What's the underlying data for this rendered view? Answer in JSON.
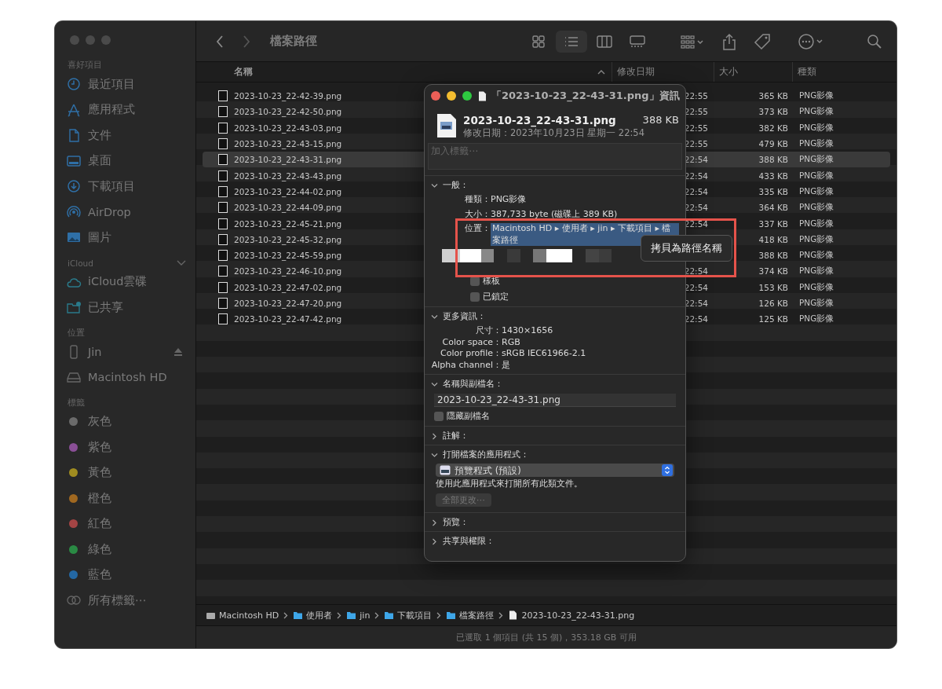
{
  "toolbar": {
    "title": "檔案路徑",
    "view_modes": [
      {
        "kind": "icons",
        "selected": false
      },
      {
        "kind": "list",
        "selected": true
      },
      {
        "kind": "columns",
        "selected": false
      },
      {
        "kind": "gallery",
        "selected": false
      }
    ]
  },
  "sidebar": {
    "sections": [
      {
        "heading": "喜好項目",
        "toggle_visible": false,
        "items": [
          {
            "label": "最近項目",
            "kind": "clock"
          },
          {
            "label": "應用程式",
            "kind": "apps"
          },
          {
            "label": "文件",
            "kind": "doc"
          },
          {
            "label": "桌面",
            "kind": "desktop"
          },
          {
            "label": "下載項目",
            "kind": "download"
          },
          {
            "label": "AirDrop",
            "kind": "airdrop"
          },
          {
            "label": "圖片",
            "kind": "photos"
          }
        ]
      },
      {
        "heading": "iCloud",
        "toggle_visible": true,
        "items": [
          {
            "label": "iCloud雲碟",
            "kind": "cloud"
          },
          {
            "label": "已共享",
            "kind": "shared"
          }
        ]
      },
      {
        "heading": "位置",
        "toggle_visible": false,
        "items": [
          {
            "label": "Jin",
            "kind": "phone",
            "ejectable": true
          },
          {
            "label": "Macintosh HD",
            "kind": "disk",
            "ejectable": false
          }
        ]
      },
      {
        "heading": "標籤",
        "toggle_visible": false,
        "items": [
          {
            "label": "灰色",
            "kind": "tag",
            "color": "#6b6b6b"
          },
          {
            "label": "紫色",
            "kind": "tag",
            "color": "#8a4f96"
          },
          {
            "label": "黃色",
            "kind": "tag",
            "color": "#a08c20"
          },
          {
            "label": "橙色",
            "kind": "tag",
            "color": "#a06820"
          },
          {
            "label": "紅色",
            "kind": "tag",
            "color": "#a44444"
          },
          {
            "label": "綠色",
            "kind": "tag",
            "color": "#2a8a44"
          },
          {
            "label": "藍色",
            "kind": "tag",
            "color": "#2468a4"
          },
          {
            "label": "所有標籤⋯",
            "kind": "alltags"
          }
        ]
      }
    ]
  },
  "table": {
    "columns": [
      {
        "label": "名稱",
        "sorted": true
      },
      {
        "label": "修改日期",
        "sorted": false
      },
      {
        "label": "大小",
        "sorted": false
      },
      {
        "label": "種類",
        "sorted": false
      }
    ],
    "rows": [
      {
        "name": "2023-10-23_22-42-39.png",
        "modified": "22:55",
        "size": "365 KB",
        "kind": "PNG影像",
        "selected": false
      },
      {
        "name": "2023-10-23_22-42-50.png",
        "modified": "22:55",
        "size": "373 KB",
        "kind": "PNG影像",
        "selected": false
      },
      {
        "name": "2023-10-23_22-43-03.png",
        "modified": "22:55",
        "size": "382 KB",
        "kind": "PNG影像",
        "selected": false
      },
      {
        "name": "2023-10-23_22-43-15.png",
        "modified": "22:55",
        "size": "479 KB",
        "kind": "PNG影像",
        "selected": false
      },
      {
        "name": "2023-10-23_22-43-31.png",
        "modified": "22:54",
        "size": "388 KB",
        "kind": "PNG影像",
        "selected": true
      },
      {
        "name": "2023-10-23_22-43-43.png",
        "modified": "22:54",
        "size": "433 KB",
        "kind": "PNG影像",
        "selected": false
      },
      {
        "name": "2023-10-23_22-44-02.png",
        "modified": "22:54",
        "size": "335 KB",
        "kind": "PNG影像",
        "selected": false
      },
      {
        "name": "2023-10-23_22-44-09.png",
        "modified": "22:54",
        "size": "364 KB",
        "kind": "PNG影像",
        "selected": false
      },
      {
        "name": "2023-10-23_22-45-21.png",
        "modified": "22:54",
        "size": "337 KB",
        "kind": "PNG影像",
        "selected": false
      },
      {
        "name": "2023-10-23_22-45-32.png",
        "size": "418 KB",
        "kind": "PNG影像",
        "selected": false
      },
      {
        "name": "2023-10-23_22-45-59.png",
        "size": "388 KB",
        "kind": "PNG影像",
        "selected": false
      },
      {
        "name": "2023-10-23_22-46-10.png",
        "modified": "22:54",
        "size": "374 KB",
        "kind": "PNG影像",
        "selected": false
      },
      {
        "name": "2023-10-23_22-47-02.png",
        "modified": "22:54",
        "size": "153 KB",
        "kind": "PNG影像",
        "selected": false
      },
      {
        "name": "2023-10-23_22-47-20.png",
        "modified": "22:54",
        "size": "126 KB",
        "kind": "PNG影像",
        "selected": false
      },
      {
        "name": "2023-10-23_22-47-42.png",
        "modified": "22:54",
        "size": "125 KB",
        "kind": "PNG影像",
        "selected": false
      }
    ]
  },
  "path_bar": [
    {
      "label": "Macintosh HD",
      "kind": "disk"
    },
    {
      "label": "使用者",
      "kind": "folder"
    },
    {
      "label": "jin",
      "kind": "folder"
    },
    {
      "label": "下載項目",
      "kind": "folder"
    },
    {
      "label": "檔案路徑",
      "kind": "folder"
    },
    {
      "label": "2023-10-23_22-43-31.png",
      "kind": "file"
    }
  ],
  "status_bar": "已選取 1 個項目 (共 15 個)，353.18 GB 可用",
  "info_window": {
    "title": "「2023-10-23_22-43-31.png」資訊",
    "file_name": "2023-10-23_22-43-31.png",
    "file_size": "388 KB",
    "modified": "修改日期：2023年10月23日 星期一 22:54",
    "tags_placeholder": "加入標籤⋯",
    "sections": [
      {
        "kind": "general",
        "title": "一般：",
        "expanded": true,
        "rows": [
          {
            "label": "種類：",
            "value": "PNG影像",
            "selected": false
          },
          {
            "label": "大小：",
            "value": "387,733 byte (磁碟上 389 KB)",
            "selected": false
          },
          {
            "label": "位置：",
            "value": "Macintosh HD ▸ 使用者 ▸ jin ▸ 下載項目 ▸ 檔案路徑",
            "selected": true
          }
        ],
        "checkboxes": [
          {
            "label": "樣板",
            "checked": false
          },
          {
            "label": "已鎖定",
            "checked": false
          }
        ]
      },
      {
        "kind": "more_info",
        "title": "更多資訊：",
        "expanded": true,
        "rows": [
          {
            "label": "尺寸：",
            "value": "1430×1656"
          },
          {
            "label": "Color space：",
            "value": "RGB"
          },
          {
            "label": "Color profile：",
            "value": "sRGB IEC61966-2.1"
          },
          {
            "label": "Alpha channel：",
            "value": "是"
          }
        ]
      },
      {
        "kind": "name",
        "title": "名稱與副檔名：",
        "expanded": true,
        "value": "2023-10-23_22-43-31.png",
        "checkboxes": [
          {
            "label": "隱藏副檔名",
            "checked": false
          }
        ]
      },
      {
        "kind": "comments",
        "title": "註解：",
        "expanded": false
      },
      {
        "kind": "open_with",
        "title": "打開檔案的應用程式：",
        "expanded": true,
        "app": "預覽程式 (預設)",
        "note": "使用此應用程式來打開所有此類文件。",
        "button": {
          "label": "全部更改⋯",
          "disabled": true
        }
      },
      {
        "kind": "preview",
        "title": "預覽：",
        "expanded": false
      },
      {
        "kind": "sharing",
        "title": "共享與權限：",
        "expanded": false
      }
    ]
  },
  "context_menu": {
    "items": [
      "拷貝為路徑名稱"
    ]
  }
}
